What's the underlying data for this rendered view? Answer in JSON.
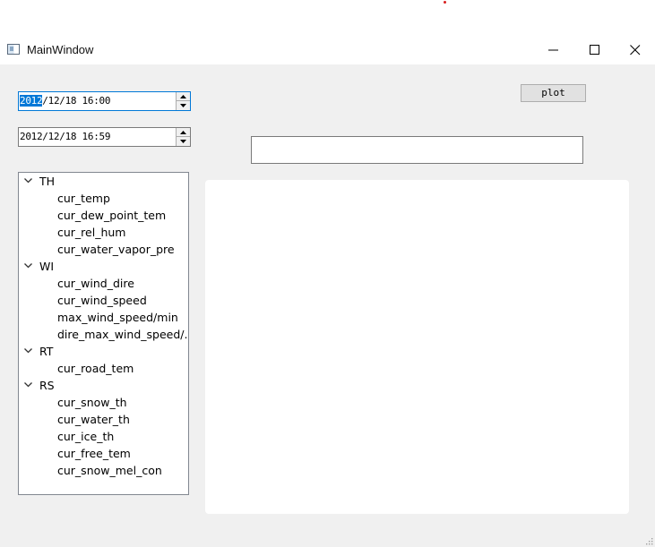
{
  "window": {
    "title": "MainWindow",
    "controls": {
      "minimize": "minimize-icon",
      "maximize": "maximize-icon",
      "close": "close-icon"
    }
  },
  "start_datetime": {
    "selected_part": "2012",
    "rest": "/12/18 16:00"
  },
  "end_datetime": {
    "value": "2012/12/18 16:59"
  },
  "plot_button": {
    "label": "plot"
  },
  "text_input": {
    "value": ""
  },
  "tree": [
    {
      "label": "TH",
      "children": [
        "cur_temp",
        "cur_dew_point_tem",
        "cur_rel_hum",
        "cur_water_vapor_pre"
      ]
    },
    {
      "label": "WI",
      "children": [
        "cur_wind_dire",
        "cur_wind_speed",
        "max_wind_speed/min",
        "dire_max_wind_speed/..."
      ]
    },
    {
      "label": "RT",
      "children": [
        "cur_road_tem"
      ]
    },
    {
      "label": "RS",
      "children": [
        "cur_snow_th",
        "cur_water_th",
        "cur_ice_th",
        "cur_free_tem",
        "cur_snow_mel_con"
      ]
    }
  ],
  "colors": {
    "selection": "#0078d7",
    "background": "#f0f0f0"
  }
}
